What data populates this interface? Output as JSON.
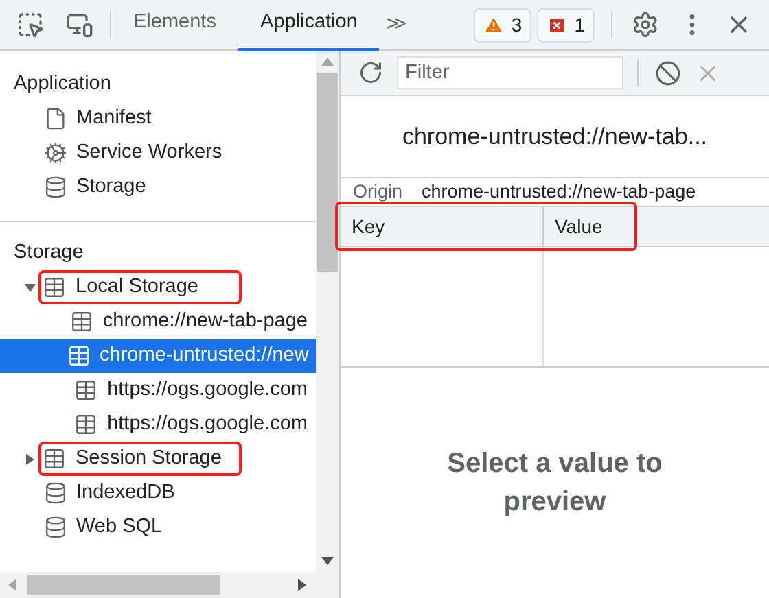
{
  "tabs": [
    {
      "label": "Elements",
      "selected": false
    },
    {
      "label": "Application",
      "selected": true
    }
  ],
  "more_tabs": ">>",
  "badges": [
    {
      "kind": "warning",
      "count": "3"
    },
    {
      "kind": "error",
      "count": "1"
    }
  ],
  "sidebar": {
    "sections": [
      {
        "title": "Application",
        "items": [
          {
            "label": "Manifest",
            "kind": "file",
            "selected": false,
            "highlighted": false
          },
          {
            "label": "Service Workers",
            "kind": "workers",
            "selected": false,
            "highlighted": false
          },
          {
            "label": "Storage",
            "kind": "database",
            "selected": false,
            "highlighted": false
          }
        ]
      },
      {
        "title": "Storage",
        "items": [
          {
            "label": "Local Storage",
            "kind": "table",
            "expanded": true,
            "selected": false,
            "highlighted": true,
            "children": [
              {
                "label": "chrome://new-tab-page",
                "kind": "table",
                "selected": false,
                "highlighted": false
              },
              {
                "label": "chrome-untrusted://new",
                "kind": "table",
                "selected": true,
                "highlighted": false
              },
              {
                "label": "https://ogs.google.com",
                "kind": "table",
                "selected": false,
                "highlighted": false
              },
              {
                "label": "https://ogs.google.com",
                "kind": "table",
                "selected": false,
                "highlighted": false
              }
            ]
          },
          {
            "label": "Session Storage",
            "kind": "table",
            "expanded": false,
            "selected": false,
            "highlighted": true
          },
          {
            "label": "IndexedDB",
            "kind": "database",
            "selected": false,
            "highlighted": false
          },
          {
            "label": "Web SQL",
            "kind": "database",
            "selected": false,
            "highlighted": false
          }
        ]
      }
    ]
  },
  "filter": {
    "placeholder": "Filter"
  },
  "origin_title": "chrome-untrusted://new-tab...",
  "origin": {
    "label": "Origin",
    "value": "chrome-untrusted://new-tab-page"
  },
  "table": {
    "columns": [
      "Key",
      "Value"
    ],
    "header_highlighted": true
  },
  "preview_message": "Select a value to preview"
}
